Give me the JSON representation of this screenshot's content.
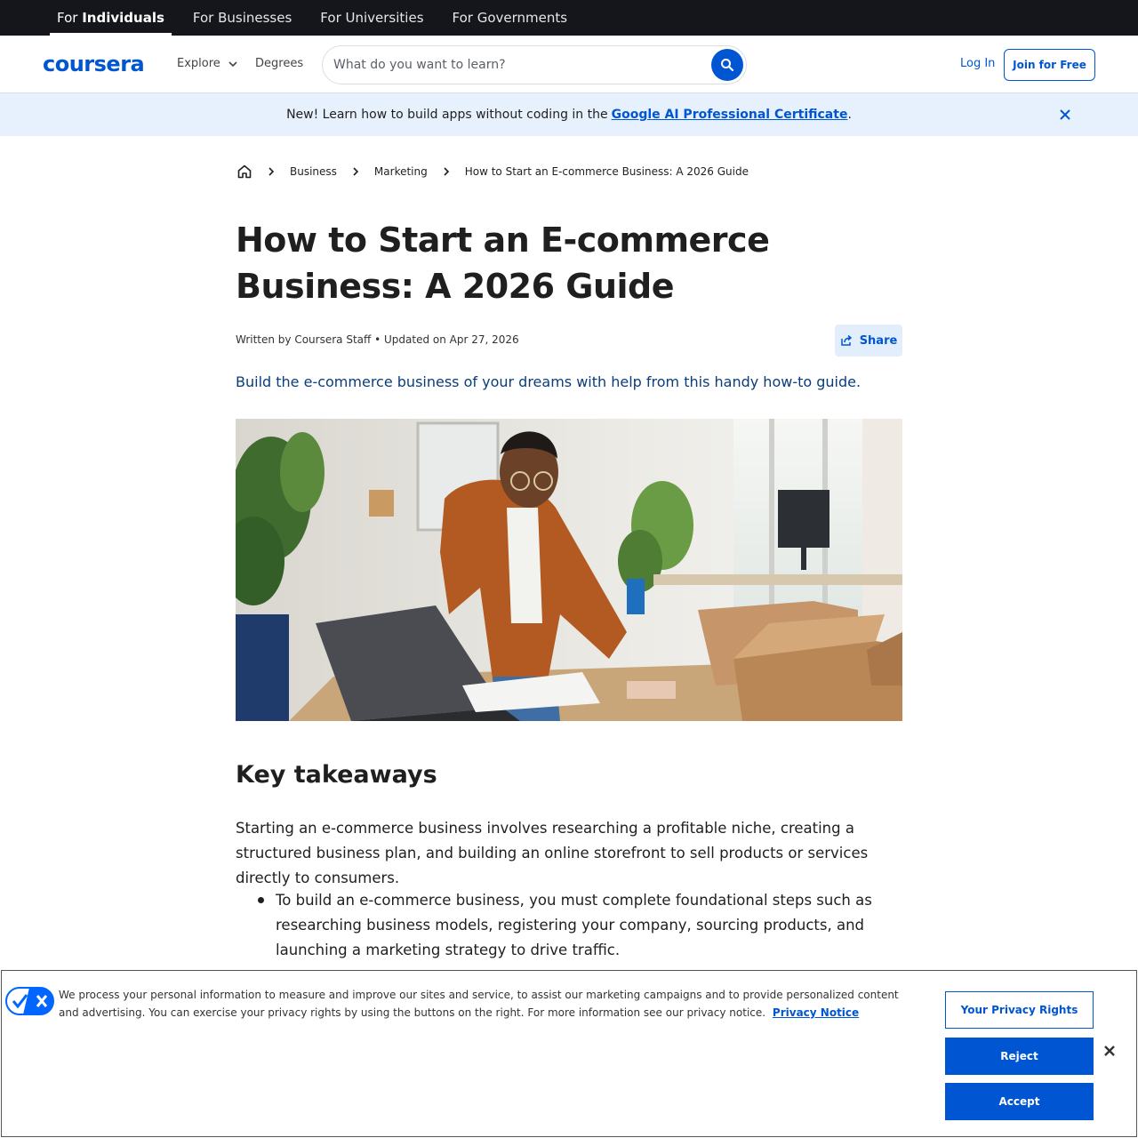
{
  "audience_bar": {
    "tabs": [
      {
        "prefix": "For ",
        "bold": "Individuals",
        "active": true
      },
      {
        "label": "For Businesses"
      },
      {
        "label": "For Universities"
      },
      {
        "label": "For Governments"
      }
    ]
  },
  "header": {
    "logo_text": "coursera",
    "explore_label": "Explore",
    "degrees_label": "Degrees",
    "search_placeholder": "What do you want to learn?",
    "login_label": "Log In",
    "join_label": "Join for Free"
  },
  "announcement": {
    "text": "New! Learn how to build apps without coding in the",
    "link_text": "Google AI Professional Certificate",
    "suffix": "."
  },
  "breadcrumb": {
    "items": [
      "Business",
      "Marketing",
      "How to Start an E-commerce Business: A 2026 Guide"
    ]
  },
  "article": {
    "title": "How to Start an E-commerce Business: A 2026 Guide",
    "byline": "Written by Coursera Staff • Updated on Apr 27, 2026",
    "share_label": "Share",
    "subtitle": "Build the e-commerce business of your dreams with help from this handy how-to guide.",
    "section_heading": "Key takeaways",
    "intro": "Starting an e-commerce business involves researching a profitable niche, creating a structured business plan, and building an online storefront to sell products or services directly to consumers.",
    "bullets": [
      "To build an e-commerce business, you must complete foundational steps such as researching business models, registering your company, sourcing products, and launching a marketing strategy to drive traffic."
    ]
  },
  "cookie_banner": {
    "text": "We process your personal information to measure and improve our sites and service, to assist our marketing campaigns and to provide personalized content and advertising. You can exercise your privacy rights by using the buttons on the right. For more information see our privacy notice.",
    "link_text": "Privacy Notice",
    "privacy_rights_label": "Your Privacy Rights",
    "reject_label": "Reject",
    "accept_label": "Accept"
  },
  "colors": {
    "brand": "#0056d2",
    "top_bar": "#14161b",
    "announcement_bg": "#e7f1fe"
  }
}
